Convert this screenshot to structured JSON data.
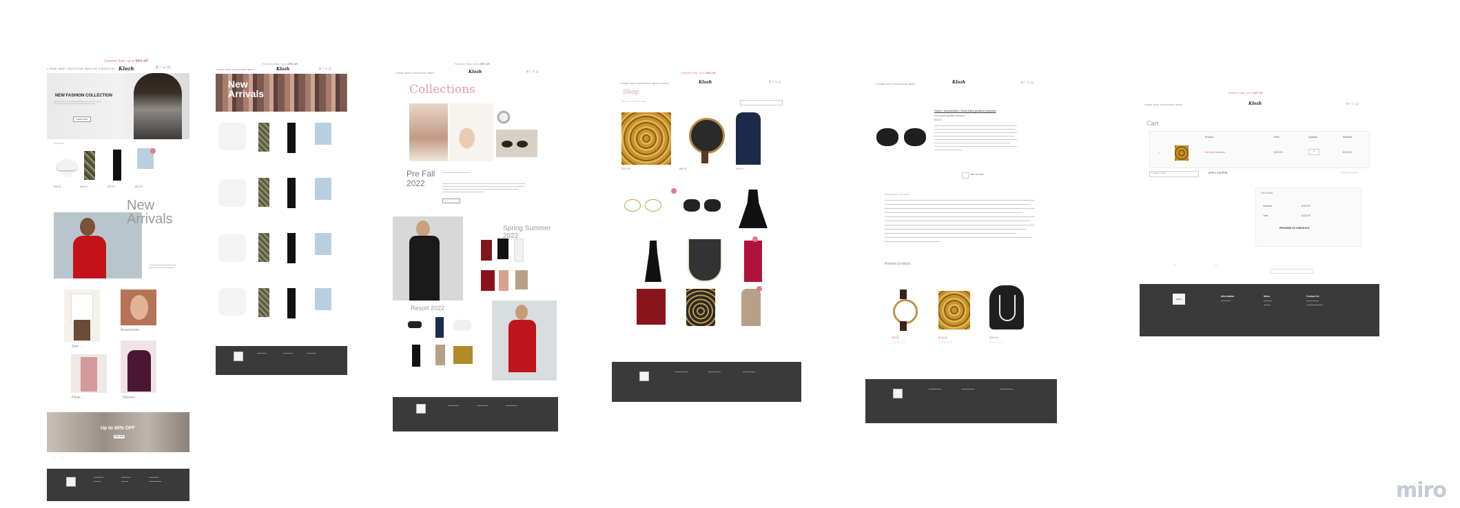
{
  "board": {
    "watermark": "miro"
  },
  "frame1": {
    "promo_text": "Summer Sale: up to ",
    "promo_pct": "60% off",
    "logo": "Klozh",
    "hero_title": "NEW FASHION COLLECTION",
    "hero_button": "SHOP NOW",
    "new_arrivals_1": "New",
    "new_arrivals_2": "Arrivals",
    "cat_skirt": "Skirt",
    "cat_accessories": "Accessories",
    "cat_pants": "Pants",
    "cat_dresses": "Dresses",
    "banner_text": "Up to 60% OFF",
    "banner_button": "SHOP NOW"
  },
  "frame2": {
    "promo_text": "Summer Sale: up to ",
    "promo_pct": "60% off",
    "logo": "Klozh",
    "hero_title_1": "New",
    "hero_title_2": "Arrivals"
  },
  "frame3": {
    "promo_text": "Summer Sale: up to ",
    "promo_pct": "60% off",
    "logo": "Klozh",
    "collections_title": "Collections",
    "prefall_1": "Pre Fall",
    "prefall_2": "2022",
    "spring_1": "Spring Summer",
    "spring_2": "2022",
    "resort": "Resort 2022"
  },
  "frame4": {
    "promo_text": "Summer Sale: up to ",
    "promo_pct": "60% off",
    "logo": "Klozh",
    "shop_title": "Shop"
  },
  "frame5": {
    "logo": "Klozh",
    "breadcrumb": "Home / Accessories / Dora black gradient eyewear",
    "product_name": "Dora black gradient eyewear",
    "product_price": "$45.00",
    "add_to_cart": "ADD TO CART",
    "related_title": "Related products"
  },
  "frame6": {
    "promo_text": "Summer Sale: up to ",
    "promo_pct": "60% off",
    "logo": "Klozh",
    "cart_title": "Cart",
    "col_product": "Product",
    "col_price": "Price",
    "col_quantity": "Quantity",
    "col_subtotal": "Subtotal",
    "item_name": "Ariel gold necklace",
    "item_price": "$120.00",
    "item_qty": "1",
    "item_subtotal": "$120.00",
    "coupon_placeholder": "Coupon code",
    "apply_coupon": "APPLY COUPON",
    "update_cart": "UPDATE CART",
    "totals_title": "Cart totals",
    "subtotal_label": "Subtotal",
    "subtotal_value": "$120.00",
    "total_label": "Total",
    "total_value": "$120.00",
    "checkout": "PROCEED TO CHECKOUT",
    "footer_logo": "Klozh",
    "footer_col1": "Information",
    "footer_col2": "Menu",
    "footer_col3": "Contact Us"
  },
  "colors": {
    "accent": "#e07a84",
    "footer": "#3a3a3a"
  }
}
